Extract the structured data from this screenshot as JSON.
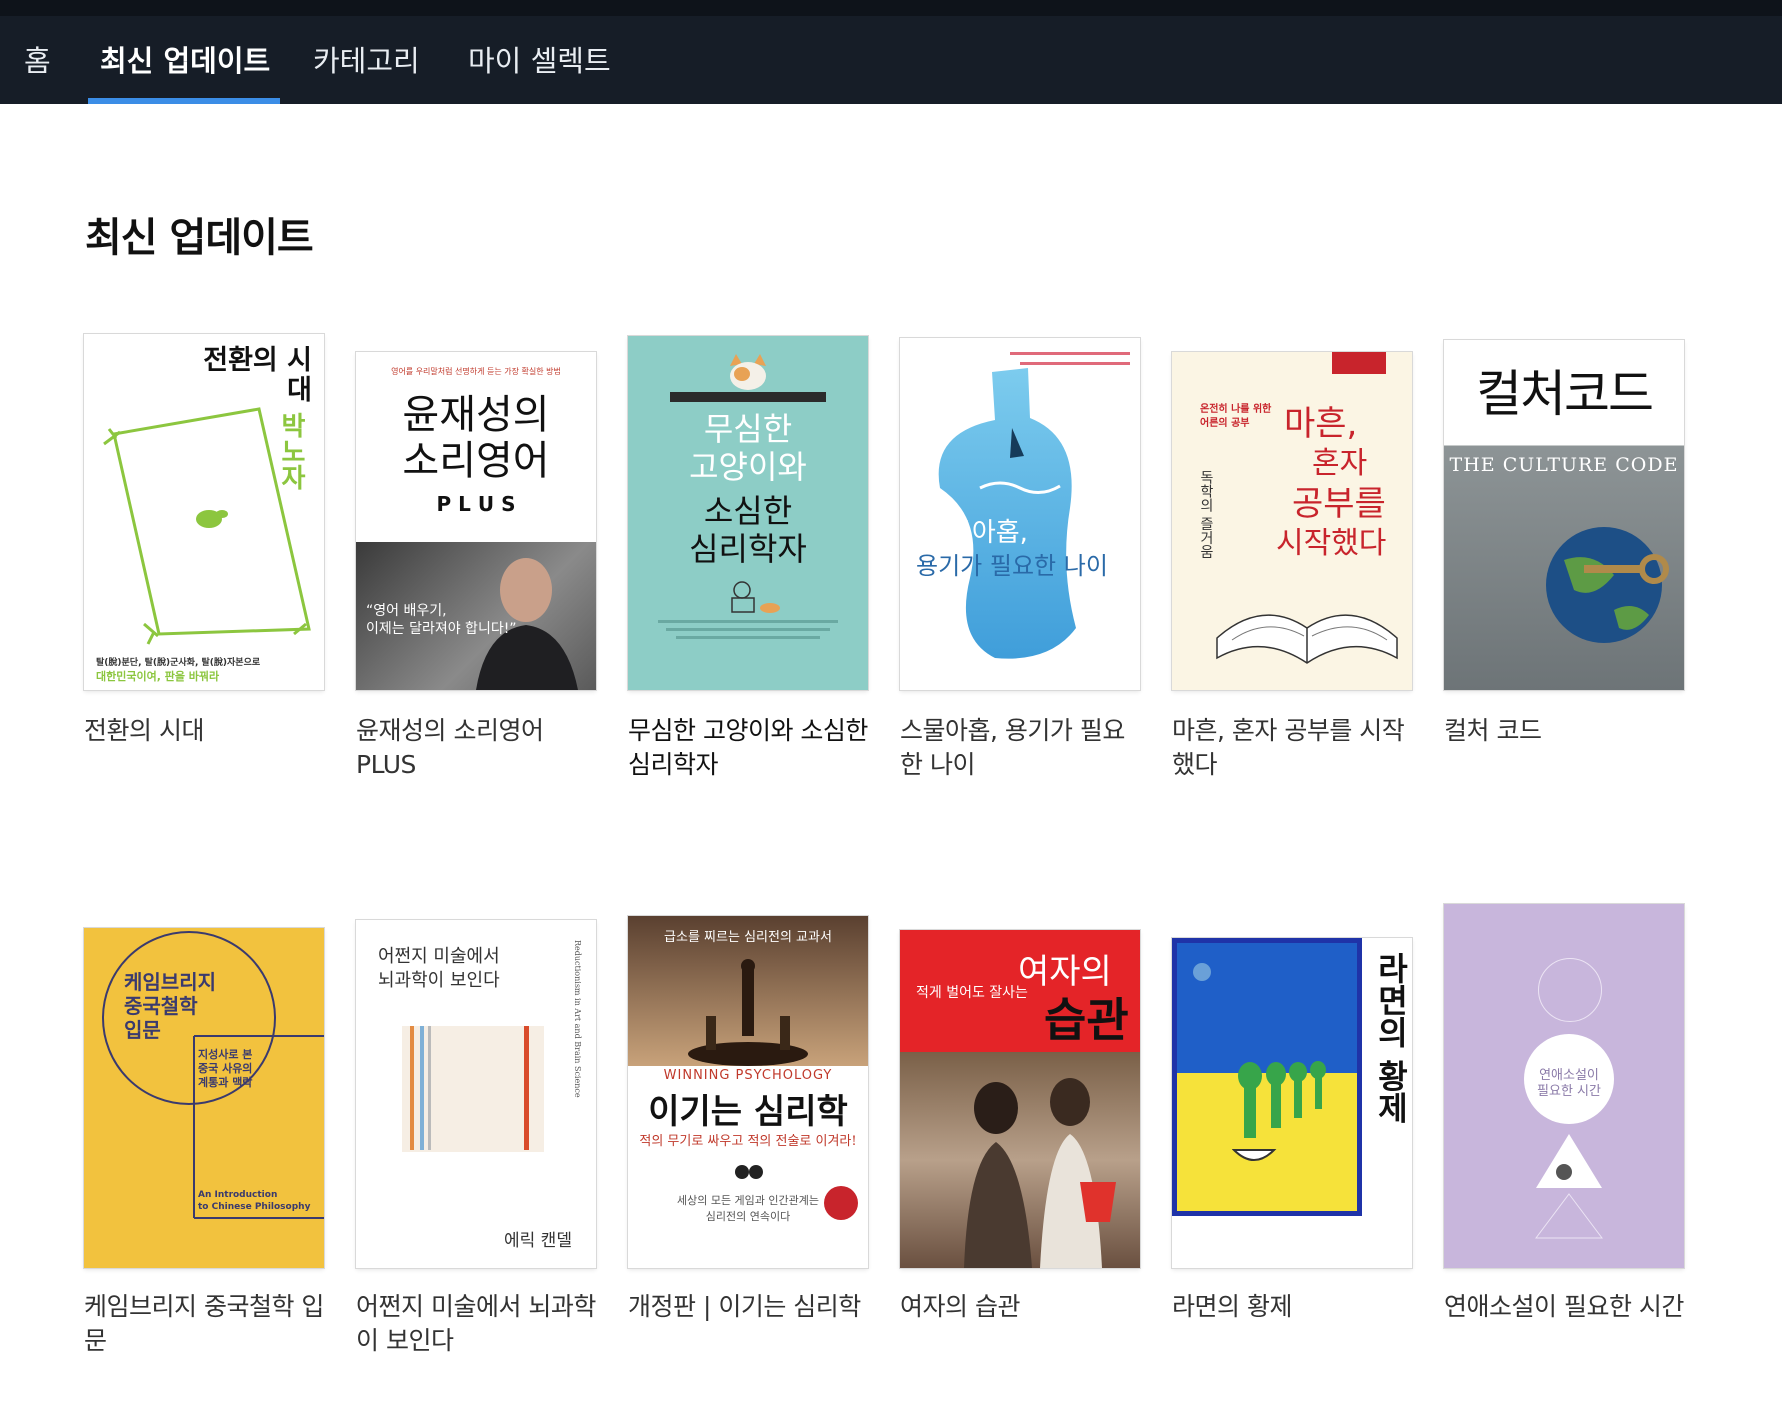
{
  "nav": {
    "tabs": [
      {
        "label": "홈"
      },
      {
        "label": "최신 업데이트",
        "active": true
      },
      {
        "label": "카테고리"
      },
      {
        "label": "마이 셀렉트"
      }
    ]
  },
  "section": {
    "title": "최신 업데이트"
  },
  "colors": {
    "nav_bg": "#161d27",
    "accent": "#3b8de6"
  },
  "books": [
    {
      "title": "전환의 시대",
      "cover": {
        "title": "전환의 시대",
        "author": "박노자",
        "tagline_1": "탈(脫)분단, 탈(脫)군사화, 탈(脫)자본으로",
        "tagline_2": "대한민국이여, 판을 바꿔라"
      }
    },
    {
      "title": "윤재성의 소리영어 PLUS",
      "cover": {
        "top": "영어를 우리말처럼 선명하게 듣는 가장 확실한 방법",
        "title_1": "윤재성의",
        "title_2": "소리영어",
        "plus": "P L U S",
        "quote_1": "“영어 배우기,",
        "quote_2": "이제는 달라져야 합니다!”"
      }
    },
    {
      "title": "무심한 고양이와 소심한 심리학자",
      "cover": {
        "title_1": "무심한",
        "title_2": "고양이와",
        "title_3": "소심한",
        "title_4": "심리학자"
      }
    },
    {
      "title": "스물아홉, 용기가 필요한 나이",
      "cover": {
        "title_1": "스물아홉,",
        "title_2": "용기가 필요한 나이"
      }
    },
    {
      "title": "마흔, 혼자 공부를 시작했다",
      "cover": {
        "subtitle_1": "온전히 나를 위한",
        "subtitle_2": "어른의 공부",
        "title_1": "마흔,",
        "title_2": "혼자",
        "title_3": "공부를",
        "title_4": "시작했다",
        "vertical": "독학의 즐거움"
      }
    },
    {
      "title": "컬처 코드",
      "cover": {
        "title": "컬처코드",
        "english": "THE CULTURE CODE"
      }
    },
    {
      "title": "케임브리지 중국철학 입문",
      "cover": {
        "title_1": "케임브리지",
        "title_2": "중국철학",
        "title_3": "입문",
        "sub_1": "지성사로 본",
        "sub_2": "중국 사유의",
        "sub_3": "계통과 맥락",
        "en_1": "An Introduction",
        "en_2": "to Chinese Philosophy"
      }
    },
    {
      "title": "어쩐지 미술에서 뇌과학이 보인다",
      "cover": {
        "title_1": "어쩐지 미술에서",
        "title_2": "뇌과학이 보인다",
        "author": "에릭 캔델",
        "vertical": "Reductionism in Art and Brain Science"
      }
    },
    {
      "title": "개정판 | 이기는 심리학",
      "cover": {
        "top": "급소를 찌르는 심리전의 교과서",
        "english": "WINNING PSYCHOLOGY",
        "title": "이기는 심리학",
        "tagline": "적의 무기로 싸우고 적의 전술로 이겨라!",
        "bottom_1": "세상의 모든 게임과 인간관계는",
        "bottom_2": "심리전의 연속이다"
      }
    },
    {
      "title": "여자의 습관",
      "cover": {
        "sub": "적게 벌어도 잘사는",
        "title_1": "여자의",
        "title_2": "습관"
      }
    },
    {
      "title": "라면의 황제",
      "cover": {
        "title": "라면의 황제"
      }
    },
    {
      "title": "연애소설이 필요한 시간",
      "cover": {
        "title_1": "연애소설이",
        "title_2": "필요한 시간"
      }
    }
  ]
}
